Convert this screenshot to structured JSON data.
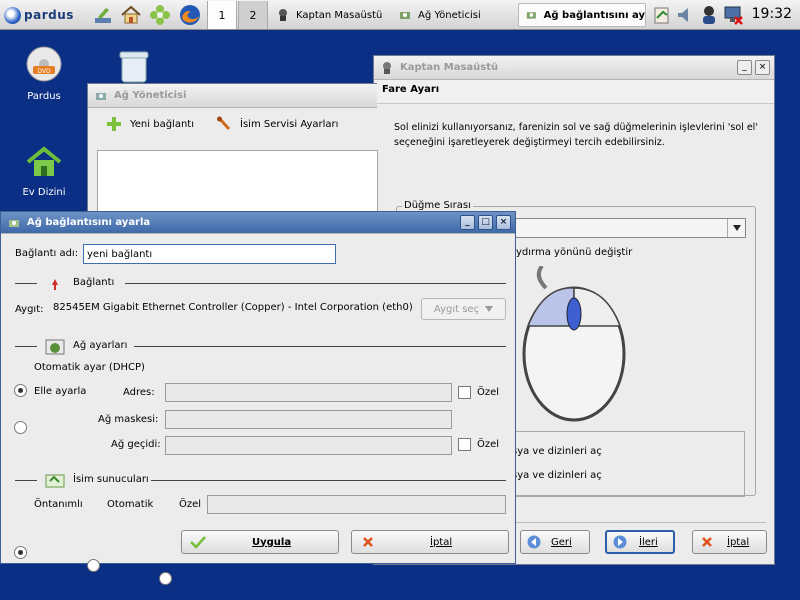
{
  "taskbar": {
    "logo": "pardus",
    "pager": [
      "1",
      "2"
    ],
    "tasks": [
      {
        "label": "Kaptan Masaüstü"
      },
      {
        "label": "Ağ Yöneticisi"
      },
      {
        "label": "Ağ bağlantısını ay"
      }
    ],
    "clock": "19:32"
  },
  "desktop": {
    "icons": [
      {
        "label": "Pardus"
      },
      {
        "label": "Ev Dizini"
      }
    ]
  },
  "kaptan": {
    "title": "Kaptan Masaüstü",
    "heading": "Fare Ayarı",
    "description": "Sol elinizi kullanıyorsanız, farenizin sol ve sağ düğmelerinin işlevlerini 'sol el' seçeneğini işaretleyerek değiştirmeyi tercih edebilirsiniz.",
    "group_label": "Düğme Sırası",
    "scroll_direction_label": "ydırma yönünü değiştir",
    "open_single": "sya ve dizinleri aç",
    "open_double": "sya ve dizinleri aç",
    "back": "Geri",
    "next": "İleri",
    "cancel": "İptal"
  },
  "ag_yoneticisi": {
    "title": "Ağ Yöneticisi",
    "new_connection": "Yeni bağlantı",
    "name_service": "İsim Servisi Ayarları"
  },
  "dialog": {
    "title": "Ağ bağlantısını ayarla",
    "connection_name_label": "Bağlantı adı:",
    "connection_name_value": "yeni bağlantı",
    "section_connection": "Bağlantı",
    "device_label": "Aygıt:",
    "device_value": "82545EM Gigabit Ethernet Controller (Copper) - Intel Corporation (eth0)",
    "device_select": "Aygıt seç",
    "section_network": "Ağ ayarları",
    "auto_dhcp": "Otomatik ayar (DHCP)",
    "manual": "Elle ayarla",
    "address_label": "Adres:",
    "netmask_label": "Ağ maskesi:",
    "gateway_label": "Ağ geçidi:",
    "custom1": "Özel",
    "custom2": "Özel",
    "section_dns": "İsim sunucuları",
    "dns_default": "Öntanımlı",
    "dns_auto": "Otomatik",
    "dns_custom": "Özel",
    "apply": "Uygula",
    "cancel": "İptal"
  },
  "colors": {
    "desktop": "#0c2f86",
    "title_active": "#4a74b0",
    "window_bg": "#ececec"
  }
}
